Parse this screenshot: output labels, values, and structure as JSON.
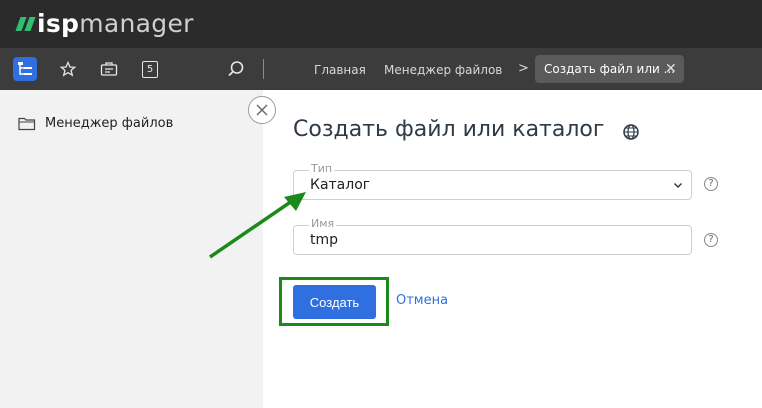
{
  "app": {
    "logo_isp": "isp",
    "logo_manager": "manager",
    "logo_color": "#2fbf71"
  },
  "toolbar": {
    "icons": [
      "tree-menu-icon",
      "star-icon",
      "briefcase-icon",
      "number-5-icon",
      "search-icon"
    ],
    "badge_number": "5",
    "breadcrumbs": [
      "Главная",
      "Менеджер файлов"
    ],
    "active_tab": "Создать файл или ...",
    "active_tab_close": "✕"
  },
  "sidebar": {
    "items": [
      {
        "label": "Менеджер файлов",
        "icon": "folder-icon"
      }
    ]
  },
  "form": {
    "title": "Создать файл или каталог",
    "type_label": "Тип",
    "type_value": "Каталог",
    "name_label": "Имя",
    "name_value": "tmp",
    "help_glyph": "?",
    "submit_label": "Создать",
    "cancel_label": "Отмена"
  },
  "colors": {
    "accent": "#2f6fe0",
    "annotation": "#1b8a1b",
    "topbar": "#2b2b2b",
    "toolbar": "#3c3c3c"
  }
}
